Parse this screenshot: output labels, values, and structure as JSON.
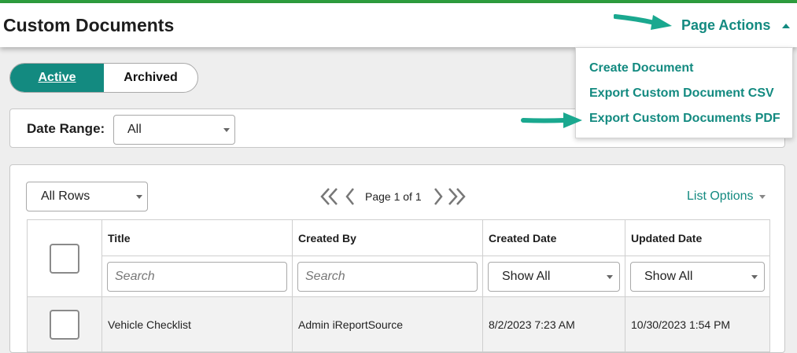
{
  "header": {
    "title": "Custom Documents",
    "page_actions_label": "Page Actions"
  },
  "page_actions_menu": {
    "items": [
      {
        "label": "Create Document"
      },
      {
        "label": "Export Custom Document CSV"
      },
      {
        "label": "Export Custom Documents PDF"
      }
    ]
  },
  "status_toggle": {
    "active_label": "Active",
    "archived_label": "Archived",
    "selected": "Active"
  },
  "filters": {
    "date_range_label": "Date Range:",
    "date_range_value": "All"
  },
  "list": {
    "rows_select_value": "All Rows",
    "pager_text": "Page 1 of 1",
    "list_options_label": "List Options",
    "columns": [
      "Title",
      "Created By",
      "Created Date",
      "Updated Date"
    ],
    "search_placeholder": "Search",
    "show_all_label": "Show All",
    "rows": [
      {
        "title": "Vehicle Checklist",
        "created_by": "Admin iReportSource",
        "created_date": "8/2/2023 7:23 AM",
        "updated_date": "10/30/2023 1:54 PM"
      }
    ]
  },
  "colors": {
    "accent": "#138a80",
    "top_stripe": "#2e9e3e",
    "annotation_arrow": "#1aa88f"
  },
  "icons": {
    "page_actions_caret": "caret-up-icon",
    "pager_first": "double-chevron-left-icon",
    "pager_prev": "chevron-left-icon",
    "pager_next": "chevron-right-icon",
    "pager_last": "double-chevron-right-icon",
    "annotation": "arrow-right-icon"
  }
}
